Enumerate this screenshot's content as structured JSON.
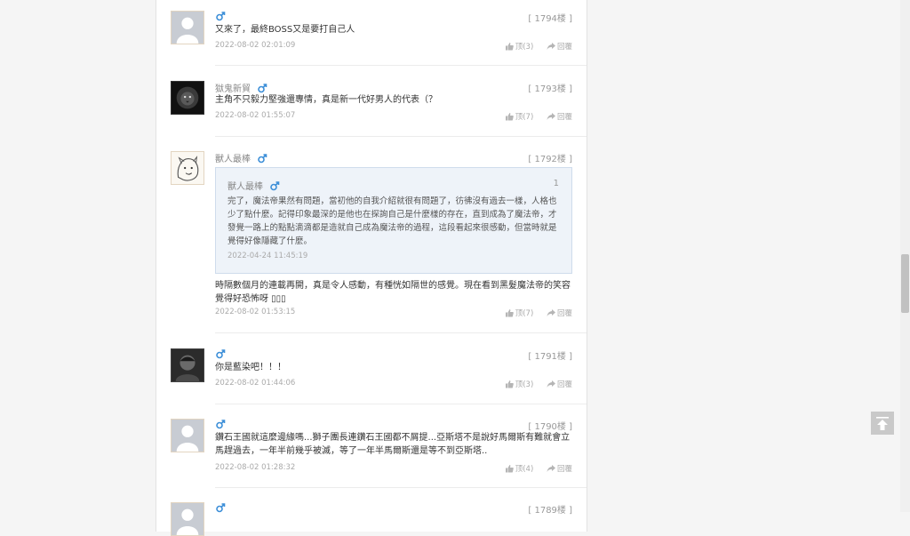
{
  "actions": {
    "like_label": "顶",
    "reply_label": "回覆"
  },
  "comments": [
    {
      "username": "",
      "floor": "[ 1794楼 ]",
      "text": "又來了，最終BOSS又是要打自己人",
      "time": "2022-08-02 02:01:09",
      "likes": "(3)",
      "avatar": "default"
    },
    {
      "username": "獄鬼新貿",
      "floor": "[ 1793楼 ]",
      "text": "主角不只毅力堅強還專情，真是新一代好男人的代表（？",
      "time": "2022-08-02 01:55:07",
      "likes": "(7)",
      "avatar": "lion"
    },
    {
      "username": "獸人最棒",
      "floor": "[ 1792楼 ]",
      "text": "時隔數個月的連載再開，真是令人感動，有種恍如隔世的感覺。現在看到黑髮魔法帝的笑容覺得好恐怖呀 ▯▯▯",
      "time": "2022-08-02 01:53:15",
      "likes": "(7)",
      "avatar": "sketch",
      "quote": {
        "username": "獸人最棒",
        "num": "1",
        "text": "完了，魔法帝果然有問題，當初他的自我介紹就很有問題了，彷彿沒有過去一樣，人格也少了點什麼。記得印象最深的是他也在探詢自己是什麼樣的存在，直到成為了魔法帝，才發覺一路上的點點滴滴都是造就自己成為魔法帝的過程，這段看起來很感動，但當時就是覺得好像隱藏了什麼。",
        "time": "2022-04-24 11:45:19"
      }
    },
    {
      "username": "",
      "floor": "[ 1791楼 ]",
      "text": "你是藍染吧！！！",
      "time": "2022-08-02 01:44:06",
      "likes": "(3)",
      "avatar": "dark"
    },
    {
      "username": "",
      "floor": "[ 1790楼 ]",
      "text": "鑽石王國就這麼邊緣嗎...獅子團長連鑽石王國都不屑提...亞斯塔不是說好馬爾斯有難就會立馬趕過去，一年半前幾乎被滅，等了一年半馬爾斯還是等不到亞斯塔..",
      "time": "2022-08-02 01:28:32",
      "likes": "(4)",
      "avatar": "default"
    },
    {
      "username": "",
      "floor": "[ 1789楼 ]",
      "text": "",
      "time": "",
      "likes": "",
      "avatar": "default"
    }
  ],
  "colors": {
    "male_icon": "#3d8fd8",
    "avatar_border": "#e3d5c1",
    "quote_bg": "#eef3f9"
  }
}
